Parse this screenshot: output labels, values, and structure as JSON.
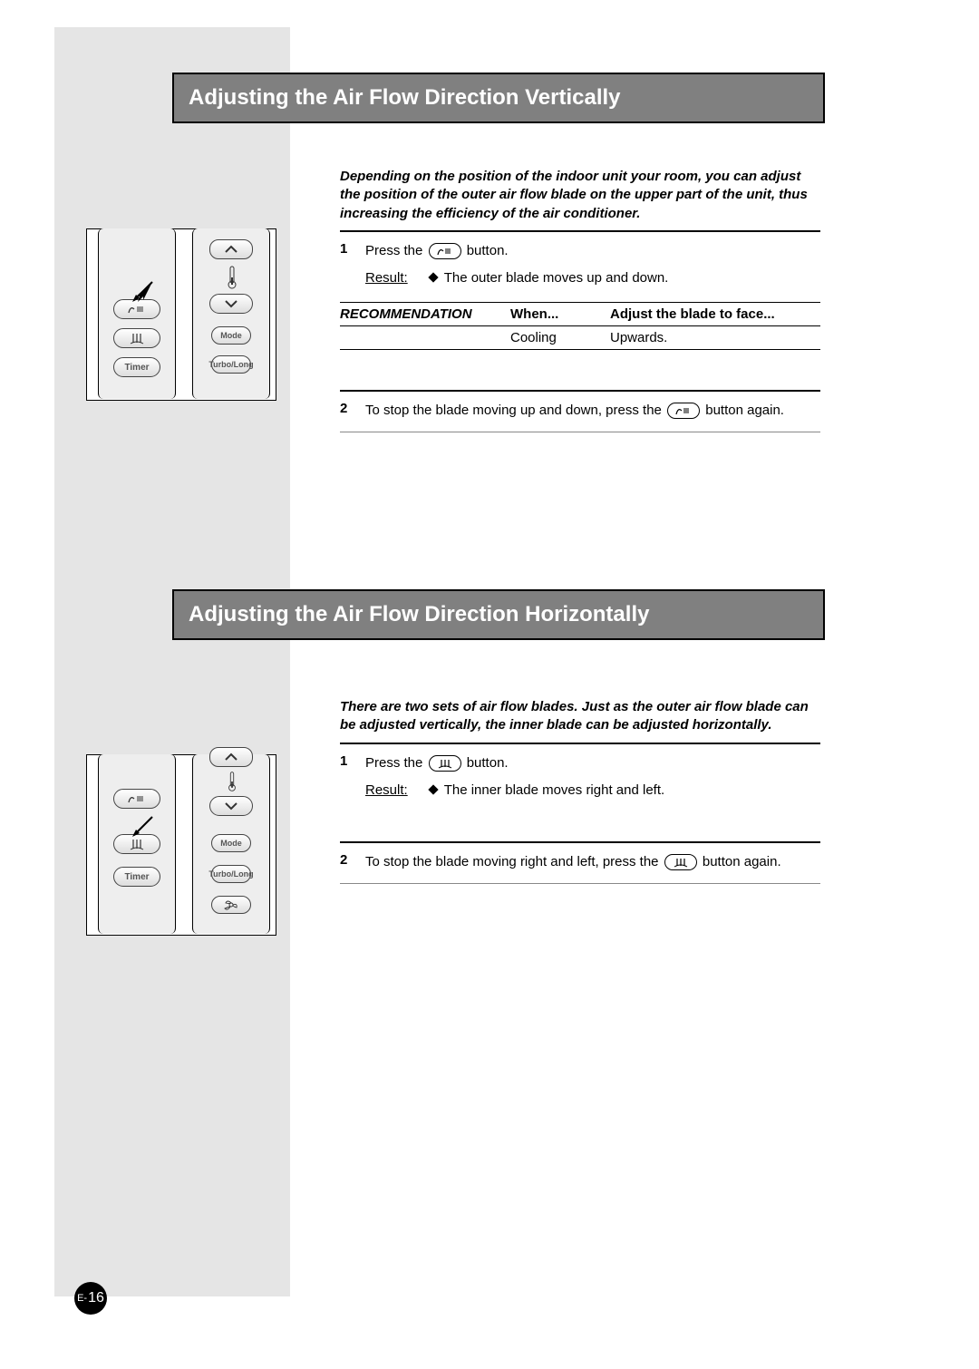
{
  "section1": {
    "title": "Adjusting the Air Flow Direction Vertically",
    "intro": "Depending on the position of the indoor unit your room, you can adjust the position of the outer air flow blade on the upper part of the unit, thus increasing the efficiency of the air conditioner.",
    "step1": {
      "num": "1",
      "before": "Press the ",
      "after": " button.",
      "result_label": "Result:",
      "result_text": "The outer blade moves up and down."
    },
    "rec": {
      "label": "RECOMMENDATION",
      "h1": "When...",
      "h2": "Adjust the blade to face...",
      "r1c1": "Cooling",
      "r1c2": "Upwards."
    },
    "step2": {
      "num": "2",
      "before": "To stop the blade moving up and down, press the ",
      "after": " button again."
    }
  },
  "section2": {
    "title": "Adjusting the Air Flow Direction Horizontally",
    "intro": "There are two sets of air flow blades. Just as the outer air flow blade can be adjusted vertically, the inner blade can be adjusted horizontally.",
    "step1": {
      "num": "1",
      "before": "Press the ",
      "after": " button.",
      "result_label": "Result:",
      "result_text": "The inner blade moves right and left."
    },
    "step2": {
      "num": "2",
      "before": "To stop the blade moving right and left, press the ",
      "after": " button again."
    }
  },
  "remote": {
    "mode": "Mode",
    "timer": "Timer",
    "turbo": "Turbo/Long"
  },
  "page": {
    "prefix": "E-",
    "num": "16"
  }
}
